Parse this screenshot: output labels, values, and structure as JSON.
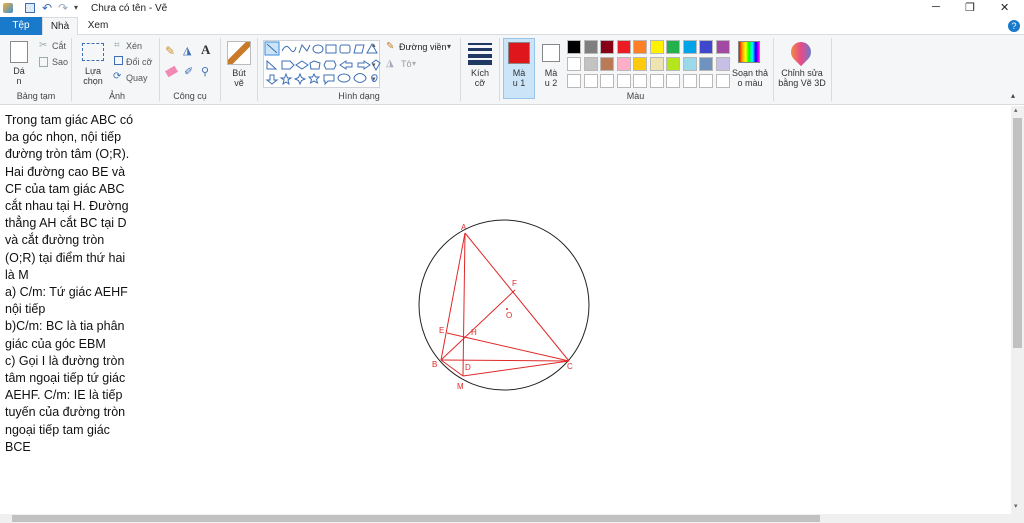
{
  "window": {
    "title": "Chưa có tên - Vẽ",
    "minimize": "─",
    "maximize": "❐",
    "close": "✕"
  },
  "tabs": [
    {
      "label": "Tệp"
    },
    {
      "label": "Nhà"
    },
    {
      "label": "Xem"
    }
  ],
  "clipboard": {
    "paste": "Dá\nn",
    "cut": "Cắt",
    "copy": "Sao",
    "group": "Bảng tạm"
  },
  "image": {
    "select": "Lựa\nchọn",
    "crop": "Xén",
    "resize": "Đổi cỡ",
    "rotate": "Quay",
    "group": "Ảnh"
  },
  "tools": {
    "group": "Công cụ"
  },
  "brushes": {
    "label": "Bút\nvẽ"
  },
  "shapes": {
    "outline": "Đường viền",
    "fill": "Tô",
    "group": "Hình dạng"
  },
  "size": {
    "label": "Kích\ncỡ"
  },
  "colors": {
    "color1": "Mà\nu 1",
    "color2": "Mà\nu 2",
    "edit": "Soạn thả\no màu",
    "paint3d": "Chỉnh sửa\nbằng Vẽ 3D",
    "group": "Màu",
    "color1_hex": "#e0161d",
    "color2_hex": "#ffffff",
    "palette_row1": [
      "#000000",
      "#7f7f7f",
      "#880015",
      "#ed1c24",
      "#ff7f27",
      "#fff200",
      "#22b14c",
      "#00a2e8",
      "#3f48cc",
      "#a349a4"
    ],
    "palette_row2": [
      "#ffffff",
      "#c3c3c3",
      "#b97a57",
      "#ffaec9",
      "#ffc90e",
      "#efe4b0",
      "#b5e61d",
      "#99d9ea",
      "#7092be",
      "#c8bfe7"
    ],
    "palette_row3": [
      "#ffffff",
      "#ffffff",
      "#ffffff",
      "#ffffff",
      "#ffffff",
      "#ffffff",
      "#ffffff",
      "#ffffff",
      "#ffffff",
      "#ffffff"
    ]
  },
  "canvas": {
    "text_lines": [
      "Trong tam giác ABC có",
      "ba góc nhọn, nội tiếp",
      "đường tròn tâm (O;R).",
      "Hai đường cao BE và",
      "CF của tam giác ABC",
      "cắt nhau tại H. Đường",
      "thẳng AH cắt BC tại D",
      "và cắt đường tròn",
      "(O;R) tại điểm thứ hai",
      "là M",
      "a) C/m: Tứ giác AEHF",
      "nội tiếp",
      "b)C/m: BC là tia phân",
      "giác của góc EBM",
      "c) Gọi I là đường tròn",
      "tâm ngoại tiếp tứ giác",
      "AEHF. C/m: IE là tiếp",
      "tuyến của đường tròn",
      "ngoại tiếp tam giác",
      "BCE"
    ],
    "points": {
      "A": "A",
      "B": "B",
      "C": "C",
      "D": "D",
      "E": "E",
      "F": "F",
      "H": "H",
      "O": "O",
      "M": "M"
    }
  }
}
